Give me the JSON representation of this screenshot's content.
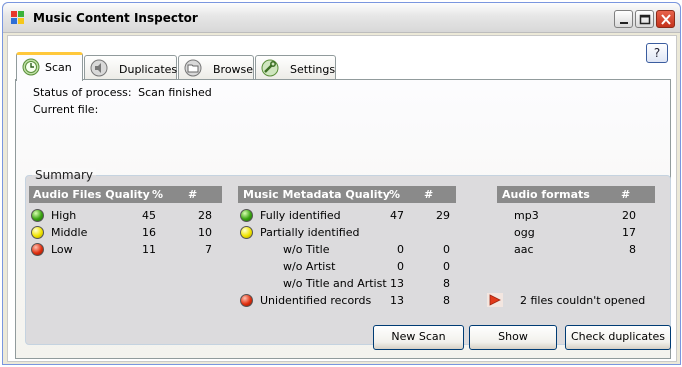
{
  "window": {
    "title": "Music Content Inspector",
    "help_label": "?"
  },
  "tabs": [
    {
      "label": "Scan",
      "icon": "clock-icon",
      "active": true
    },
    {
      "label": "Duplicates",
      "icon": "speaker-icon",
      "active": false
    },
    {
      "label": "Browse",
      "icon": "folder-icon",
      "active": false
    },
    {
      "label": "Settings",
      "icon": "wrench-icon",
      "active": false
    }
  ],
  "status": {
    "process_label": "Status of process:",
    "process_value": "Scan finished",
    "file_label": "Current file:",
    "file_value": ""
  },
  "summary": {
    "title": "Summary",
    "quality": {
      "headers": [
        "Audio Files Quality",
        "%",
        "#"
      ],
      "rows": [
        {
          "label": "High",
          "pct": "45",
          "count": "28",
          "status": "green"
        },
        {
          "label": "Middle",
          "pct": "16",
          "count": "10",
          "status": "yellow"
        },
        {
          "label": "Low",
          "pct": "11",
          "count": "7",
          "status": "red"
        }
      ]
    },
    "metadata": {
      "headers": [
        "Music Metadata Quality",
        "%",
        "#"
      ],
      "rows": [
        {
          "label": "Fully identified",
          "pct": "47",
          "count": "29",
          "status": "green"
        },
        {
          "label": "Partially identified",
          "pct": "",
          "count": "",
          "status": "yellow"
        },
        {
          "label": "w/o  Title",
          "pct": "0",
          "count": "0",
          "status": ""
        },
        {
          "label": "w/o  Artist",
          "pct": "0",
          "count": "0",
          "status": ""
        },
        {
          "label": "w/o  Title and Artist",
          "pct": "13",
          "count": "8",
          "status": ""
        },
        {
          "label": "Unidentified records",
          "pct": "13",
          "count": "8",
          "status": "red"
        }
      ]
    },
    "formats": {
      "headers": [
        "Audio formats",
        "#"
      ],
      "rows": [
        {
          "label": "mp3",
          "count": "20"
        },
        {
          "label": "ogg",
          "count": "17"
        },
        {
          "label": "aac",
          "count": "8"
        }
      ],
      "warning": "2 files couldn't opened"
    }
  },
  "buttons": {
    "new_scan": "New Scan",
    "show": "Show",
    "check_duplicates": "Check duplicates"
  },
  "colors": {
    "header_bg": "#8a8a8a",
    "active_tab_accent": "#ffc83c",
    "summary_bg": "#dcdbdd"
  }
}
